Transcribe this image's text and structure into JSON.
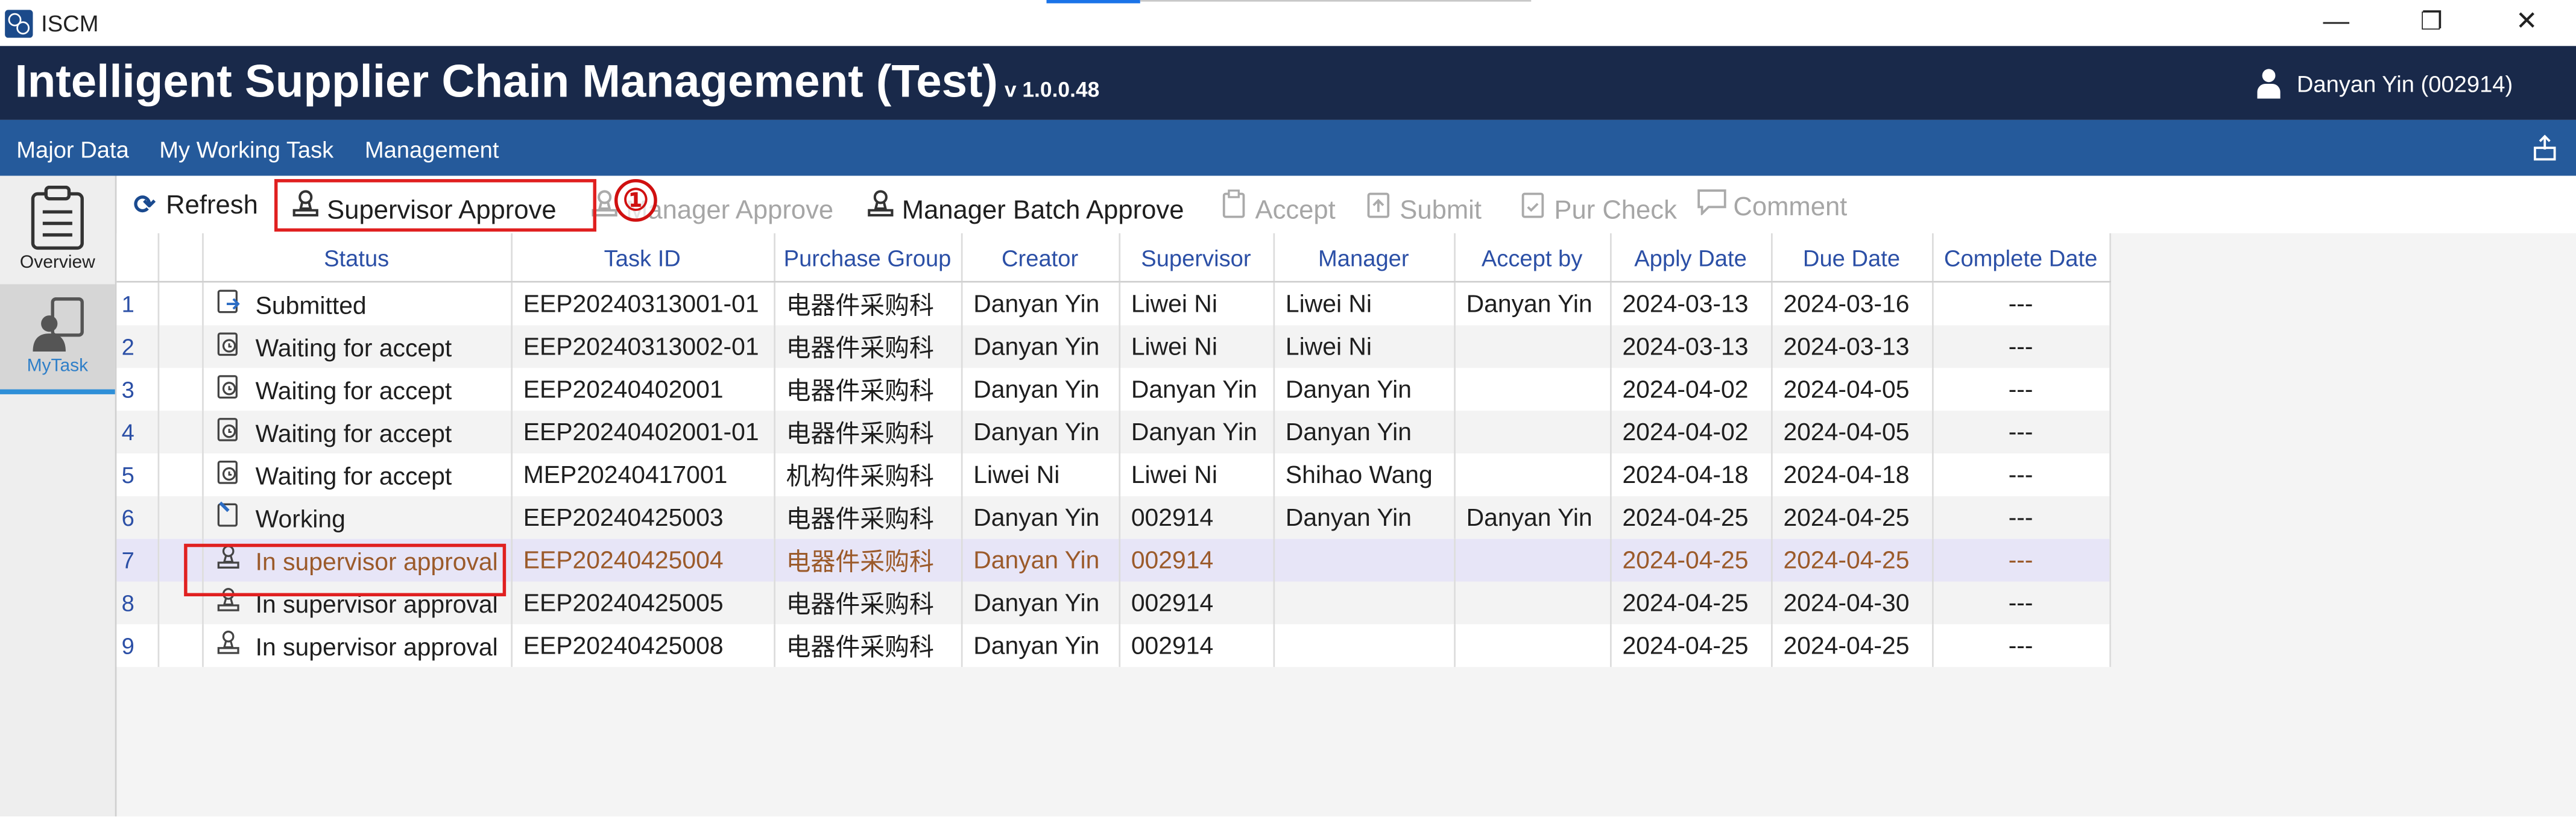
{
  "window": {
    "app_name": "ISCM",
    "minimize": "—",
    "maximize": "❐",
    "close": "✕"
  },
  "header": {
    "title": "Intelligent Supplier Chain Management (Test)",
    "version": "v 1.0.0.48",
    "user": "Danyan Yin (002914)"
  },
  "menu": {
    "items": [
      "Major Data",
      "My Working Task",
      "Management"
    ]
  },
  "nav": {
    "overview": "Overview",
    "mytask": "MyTask"
  },
  "toolbar": {
    "refresh": "Refresh",
    "supervisor_approve": "Supervisor Approve",
    "manager_approve": "Manager Approve",
    "manager_batch_approve": "Manager Batch Approve",
    "accept": "Accept",
    "submit": "Submit",
    "pur_check": "Pur Check",
    "comment": "Comment",
    "step_marker": "①"
  },
  "table": {
    "headers": [
      "Status",
      "Task ID",
      "Purchase Group",
      "Creator",
      "Supervisor",
      "Manager",
      "Accept by",
      "Apply Date",
      "Due Date",
      "Complete Date"
    ],
    "rows": [
      {
        "no": "1",
        "status": "Submitted",
        "task_id": "EEP20240313001-01",
        "group": "电器件采购科",
        "creator": "Danyan Yin",
        "supervisor": "Liwei Ni",
        "manager": "Liwei Ni",
        "accept_by": "Danyan Yin",
        "apply": "2024-03-13",
        "due": "2024-03-16",
        "complete": "---"
      },
      {
        "no": "2",
        "status": "Waiting for accept",
        "task_id": "EEP20240313002-01",
        "group": "电器件采购科",
        "creator": "Danyan Yin",
        "supervisor": "Liwei Ni",
        "manager": "Liwei Ni",
        "accept_by": "",
        "apply": "2024-03-13",
        "due": "2024-03-13",
        "complete": "---"
      },
      {
        "no": "3",
        "status": "Waiting for accept",
        "task_id": "EEP20240402001",
        "group": "电器件采购科",
        "creator": "Danyan Yin",
        "supervisor": "Danyan Yin",
        "manager": "Danyan Yin",
        "accept_by": "",
        "apply": "2024-04-02",
        "due": "2024-04-05",
        "complete": "---"
      },
      {
        "no": "4",
        "status": "Waiting for accept",
        "task_id": "EEP20240402001-01",
        "group": "电器件采购科",
        "creator": "Danyan Yin",
        "supervisor": "Danyan Yin",
        "manager": "Danyan Yin",
        "accept_by": "",
        "apply": "2024-04-02",
        "due": "2024-04-05",
        "complete": "---"
      },
      {
        "no": "5",
        "status": "Waiting for accept",
        "task_id": "MEP20240417001",
        "group": "机构件采购科",
        "creator": "Liwei Ni",
        "supervisor": "Liwei Ni",
        "manager": "Shihao Wang",
        "accept_by": "",
        "apply": "2024-04-18",
        "due": "2024-04-18",
        "complete": "---"
      },
      {
        "no": "6",
        "status": "Working",
        "task_id": "EEP20240425003",
        "group": "电器件采购科",
        "creator": "Danyan Yin",
        "supervisor": "002914",
        "manager": "Danyan Yin",
        "accept_by": "Danyan Yin",
        "apply": "2024-04-25",
        "due": "2024-04-25",
        "complete": "---"
      },
      {
        "no": "7",
        "status": "In supervisor approval",
        "task_id": "EEP20240425004",
        "group": "电器件采购科",
        "creator": "Danyan Yin",
        "supervisor": "002914",
        "manager": "",
        "accept_by": "",
        "apply": "2024-04-25",
        "due": "2024-04-25",
        "complete": "---"
      },
      {
        "no": "8",
        "status": "In supervisor approval",
        "task_id": "EEP20240425005",
        "group": "电器件采购科",
        "creator": "Danyan Yin",
        "supervisor": "002914",
        "manager": "",
        "accept_by": "",
        "apply": "2024-04-25",
        "due": "2024-04-30",
        "complete": "---"
      },
      {
        "no": "9",
        "status": "In supervisor approval",
        "task_id": "EEP20240425008",
        "group": "电器件采购科",
        "creator": "Danyan Yin",
        "supervisor": "002914",
        "manager": "",
        "accept_by": "",
        "apply": "2024-04-25",
        "due": "2024-04-25",
        "complete": "---"
      }
    ]
  },
  "colors": {
    "header_bg": "#19294a",
    "menubar_bg": "#255a9b",
    "highlight_box": "#e02020",
    "selected_row": "#e7e5f7",
    "selected_text": "#9b5a2a"
  }
}
